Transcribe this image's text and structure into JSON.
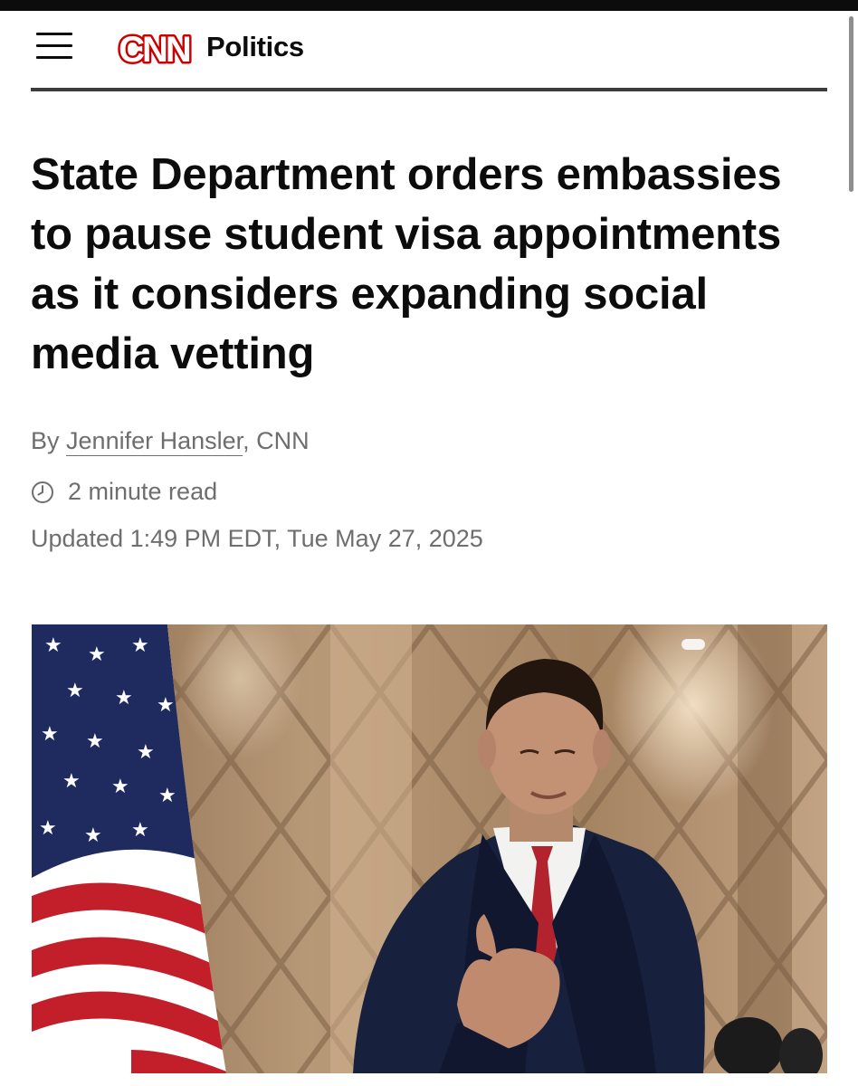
{
  "header": {
    "menu_icon": "hamburger-menu-icon",
    "logo_text": "CNN",
    "section": "Politics",
    "brand_color": "#cc0000"
  },
  "article": {
    "headline": "State Department orders embassies to pause student visa appointments as it considers expanding social media vetting",
    "byline_prefix": "By",
    "author": "Jennifer Hansler",
    "byline_suffix": ", CNN",
    "read_time_icon": "clock-icon",
    "read_time": "2 minute read",
    "updated": "Updated 1:49 PM EDT, Tue May 27, 2025"
  },
  "hero_image": {
    "description_icon": "photo"
  }
}
